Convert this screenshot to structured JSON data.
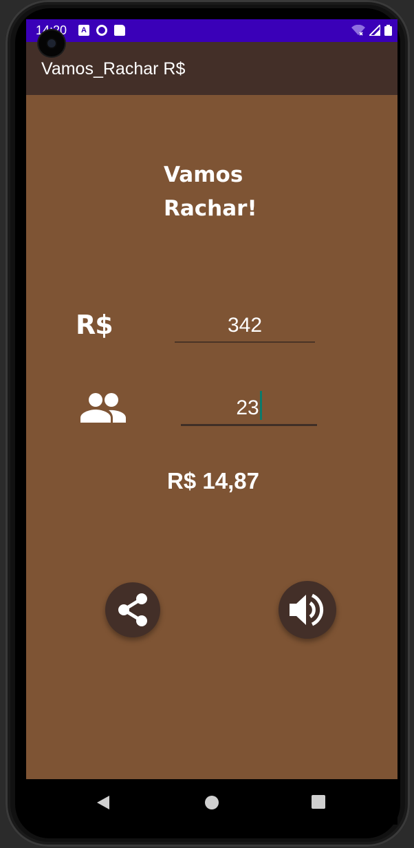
{
  "status_bar": {
    "time": "14:20",
    "color": "#3a00b8"
  },
  "app_bar": {
    "title": "Vamos_Rachar R$",
    "color": "#432f28"
  },
  "main": {
    "headline": "Vamos Rachar!",
    "currency_symbol": "R$",
    "amount_value": "342",
    "people_value": "23",
    "result_text": "R$ 14,87",
    "background_color": "#7e5434"
  },
  "actions": {
    "share_icon": "share-icon",
    "sound_icon": "volume-up-icon"
  },
  "nav": {
    "back_icon": "back-triangle-icon",
    "home_icon": "home-circle-icon",
    "recents_icon": "recents-square-icon"
  }
}
